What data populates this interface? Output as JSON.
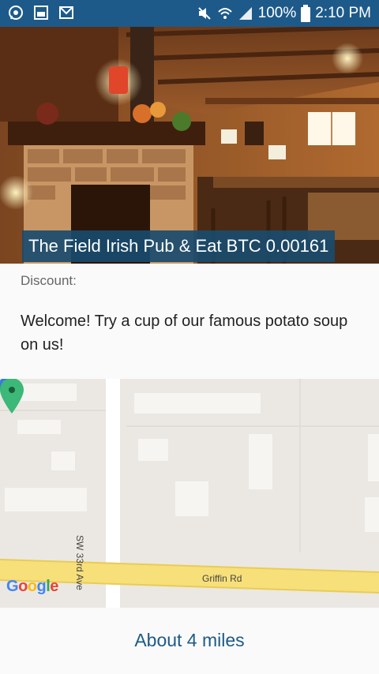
{
  "status_bar": {
    "battery": "100%",
    "time": "2:10 PM",
    "left_icons": [
      "whatsapp-icon",
      "gallery-icon",
      "gmail-icon"
    ],
    "right_icons": [
      "mute-icon",
      "wifi-icon",
      "signal-icon",
      "battery-icon"
    ]
  },
  "listing": {
    "title": "The Field Irish Pub & Eat BTC 0.00161",
    "discount_label": "Discount:",
    "discount_text": "Welcome! Try a cup of our famous potato soup on us!"
  },
  "map": {
    "street_1": "SW 33rd Ave",
    "street_2": "Griffin Rd",
    "provider": "Google",
    "pin_color": "#3cb878"
  },
  "distance": {
    "label": "About 4 miles"
  },
  "colors": {
    "status_bar": "#1d5a8a",
    "banner": "#194b6e",
    "distance_text": "#1e5a85"
  }
}
